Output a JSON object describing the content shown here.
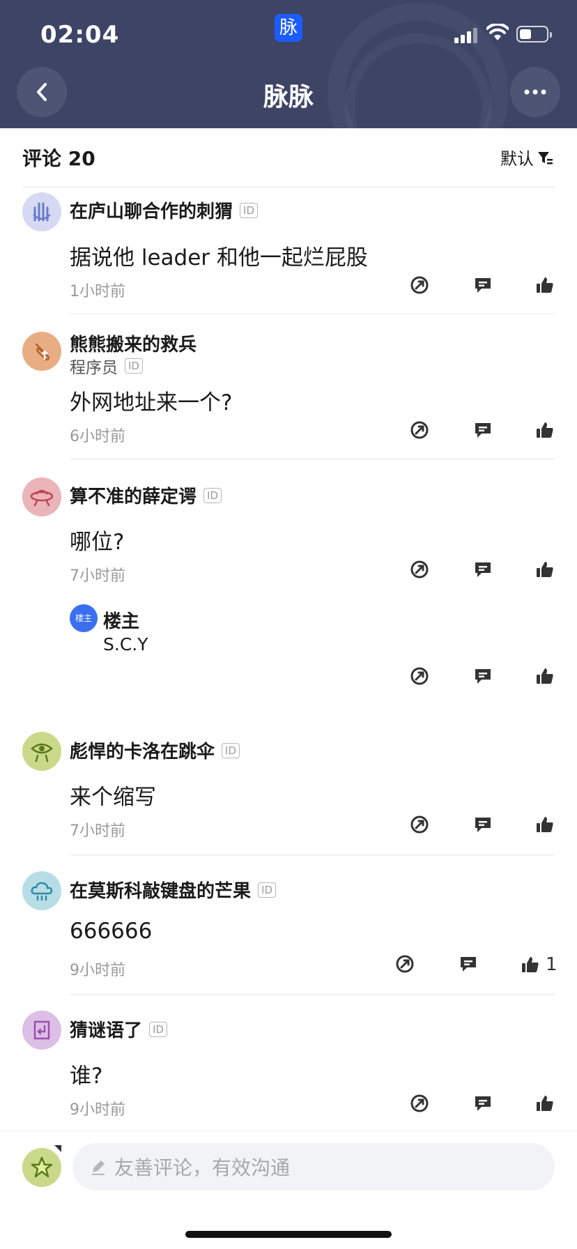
{
  "status_bar": {
    "time": "02:04",
    "app_badge": "脉"
  },
  "header": {
    "title": "脉脉",
    "back_icon": "chevron-left-icon",
    "more_icon": "ellipsis-icon"
  },
  "section": {
    "count_label": "评论 20",
    "sort_label": "默认",
    "sort_icon": "filter-sort-icon"
  },
  "comments": [
    {
      "name": "在庐山聊合作的刺猬",
      "id_badge": "ID",
      "text": "据说他 leader 和他一起烂屁股",
      "time": "1小时前"
    },
    {
      "name": "熊熊搬来的救兵",
      "job": "程序员",
      "id_badge": "ID",
      "text": "外网地址来一个?",
      "time": "6小时前"
    },
    {
      "name": "算不准的薛定谔",
      "id_badge": "ID",
      "text": "哪位?",
      "time": "7小时前",
      "reply": {
        "avatar_label": "楼主",
        "name": "楼主",
        "text": "S.C.Y"
      }
    },
    {
      "name": "彪悍的卡洛在跳伞",
      "id_badge": "ID",
      "text": "来个缩写",
      "time": "7小时前"
    },
    {
      "name": "在莫斯科敲键盘的芒果",
      "id_badge": "ID",
      "text": "666666",
      "time": "9小时前",
      "like_count": "1"
    },
    {
      "name": "猜谜语了",
      "id_badge": "ID",
      "text": "谁?",
      "time": "9小时前"
    }
  ],
  "input": {
    "placeholder": "友善评论，有效沟通"
  },
  "colors": {
    "header_bg": "#3d4466",
    "accent": "#1a5cff",
    "icon": "#333333",
    "muted": "#999999"
  }
}
